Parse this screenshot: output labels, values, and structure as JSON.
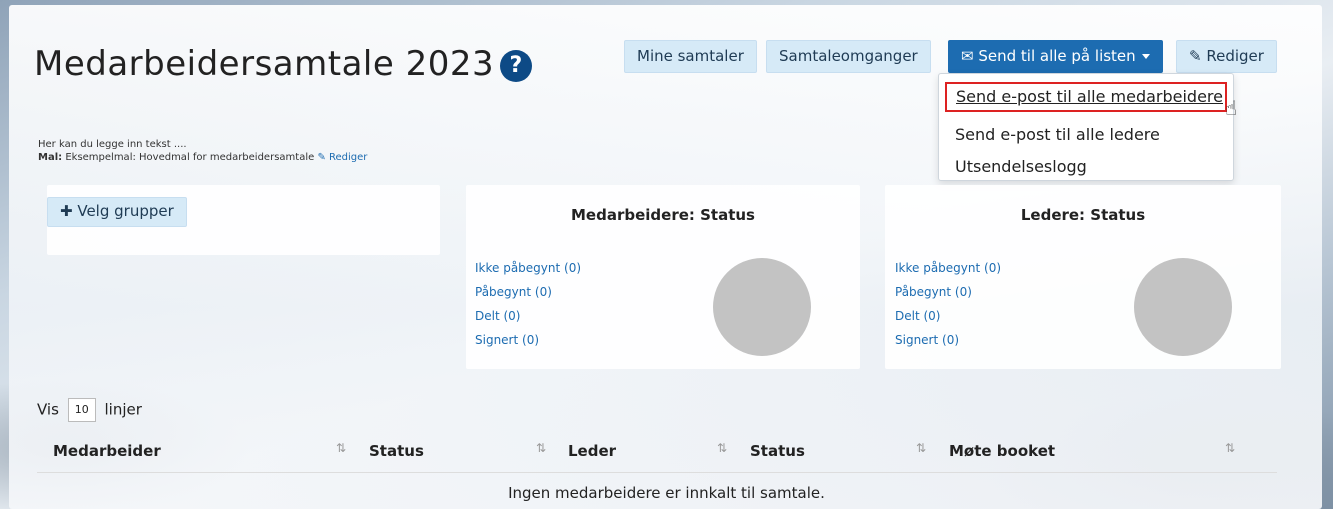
{
  "page": {
    "title": "Medarbeidersamtale 2023",
    "help_glyph": "?"
  },
  "toolbar": {
    "mine_samtaler": "Mine samtaler",
    "samtaleomganger": "Samtaleomganger",
    "send_til_alle": "Send til alle på listen",
    "rediger": "Rediger"
  },
  "dropdown": {
    "items": [
      "Send e-post til alle medarbeidere",
      "Send e-post til alle ledere",
      "Utsendelseslogg"
    ]
  },
  "intro": {
    "text": "Her kan du legge inn tekst ....",
    "mal_label": "Mal:",
    "mal_value": "Eksempelmal: Hovedmal for medarbeidersamtale",
    "rediger": "Rediger"
  },
  "groups": {
    "button": "Velg grupper"
  },
  "status_cards": [
    {
      "title": "Medarbeidere: Status",
      "items": [
        "Ikke påbegynt (0)",
        "Påbegynt (0)",
        "Delt (0)",
        "Signert (0)"
      ]
    },
    {
      "title": "Ledere: Status",
      "items": [
        "Ikke påbegynt (0)",
        "Påbegynt (0)",
        "Delt (0)",
        "Signert (0)"
      ]
    }
  ],
  "table": {
    "vis_label": "Vis",
    "page_size": "10",
    "linjer_label": "linjer",
    "columns": [
      "Medarbeider",
      "Status",
      "Leder",
      "Status",
      "Møte booket"
    ],
    "empty_message": "Ingen medarbeidere er innkalt til samtale."
  },
  "colors": {
    "accent": "#1d6cb1",
    "button_bg": "#d6eaf7",
    "highlight_border": "#d22222"
  }
}
